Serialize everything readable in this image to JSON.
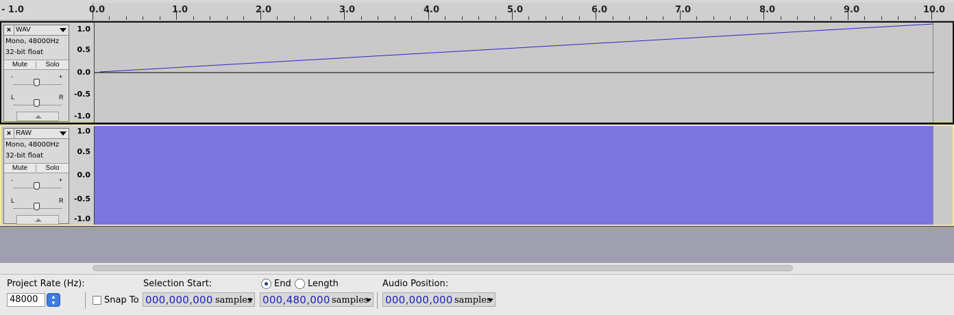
{
  "ruler": {
    "labels": [
      "- 1.0",
      "0.0",
      "1.0",
      "2.0",
      "3.0",
      "4.0",
      "5.0",
      "6.0",
      "7.0",
      "8.0",
      "9.0",
      "10.0"
    ]
  },
  "tracks": [
    {
      "name": "WAV",
      "info_line1": "Mono, 48000Hz",
      "info_line2": "32-bit float",
      "mute_label": "Mute",
      "solo_label": "Solo",
      "gain_minus": "-",
      "gain_plus": "+",
      "pan_left": "L",
      "pan_right": "R",
      "vruler": [
        "1.0",
        "0.5",
        "0.0",
        "-0.5",
        "-1.0"
      ],
      "selected": false
    },
    {
      "name": "RAW",
      "info_line1": "Mono, 48000Hz",
      "info_line2": "32-bit float",
      "mute_label": "Mute",
      "solo_label": "Solo",
      "gain_minus": "-",
      "gain_plus": "+",
      "pan_left": "L",
      "pan_right": "R",
      "vruler": [
        "1.0",
        "0.5",
        "0.0",
        "-0.5",
        "-1.0"
      ],
      "selected": true
    }
  ],
  "toolbar": {
    "project_rate_label": "Project Rate (Hz):",
    "project_rate_value": "48000",
    "snap_to_label": "Snap To",
    "selection_start_label": "Selection Start:",
    "end_label": "End",
    "length_label": "Length",
    "audio_position_label": "Audio Position:",
    "selection_start_value": "000,000,000",
    "selection_end_value": "000,480,000",
    "audio_position_value": "000,000,000",
    "units": "samples"
  },
  "colors": {
    "waveform": "#7b75e0",
    "wave_line": "#2a24c8",
    "selected_border": "#f2ef8a"
  }
}
